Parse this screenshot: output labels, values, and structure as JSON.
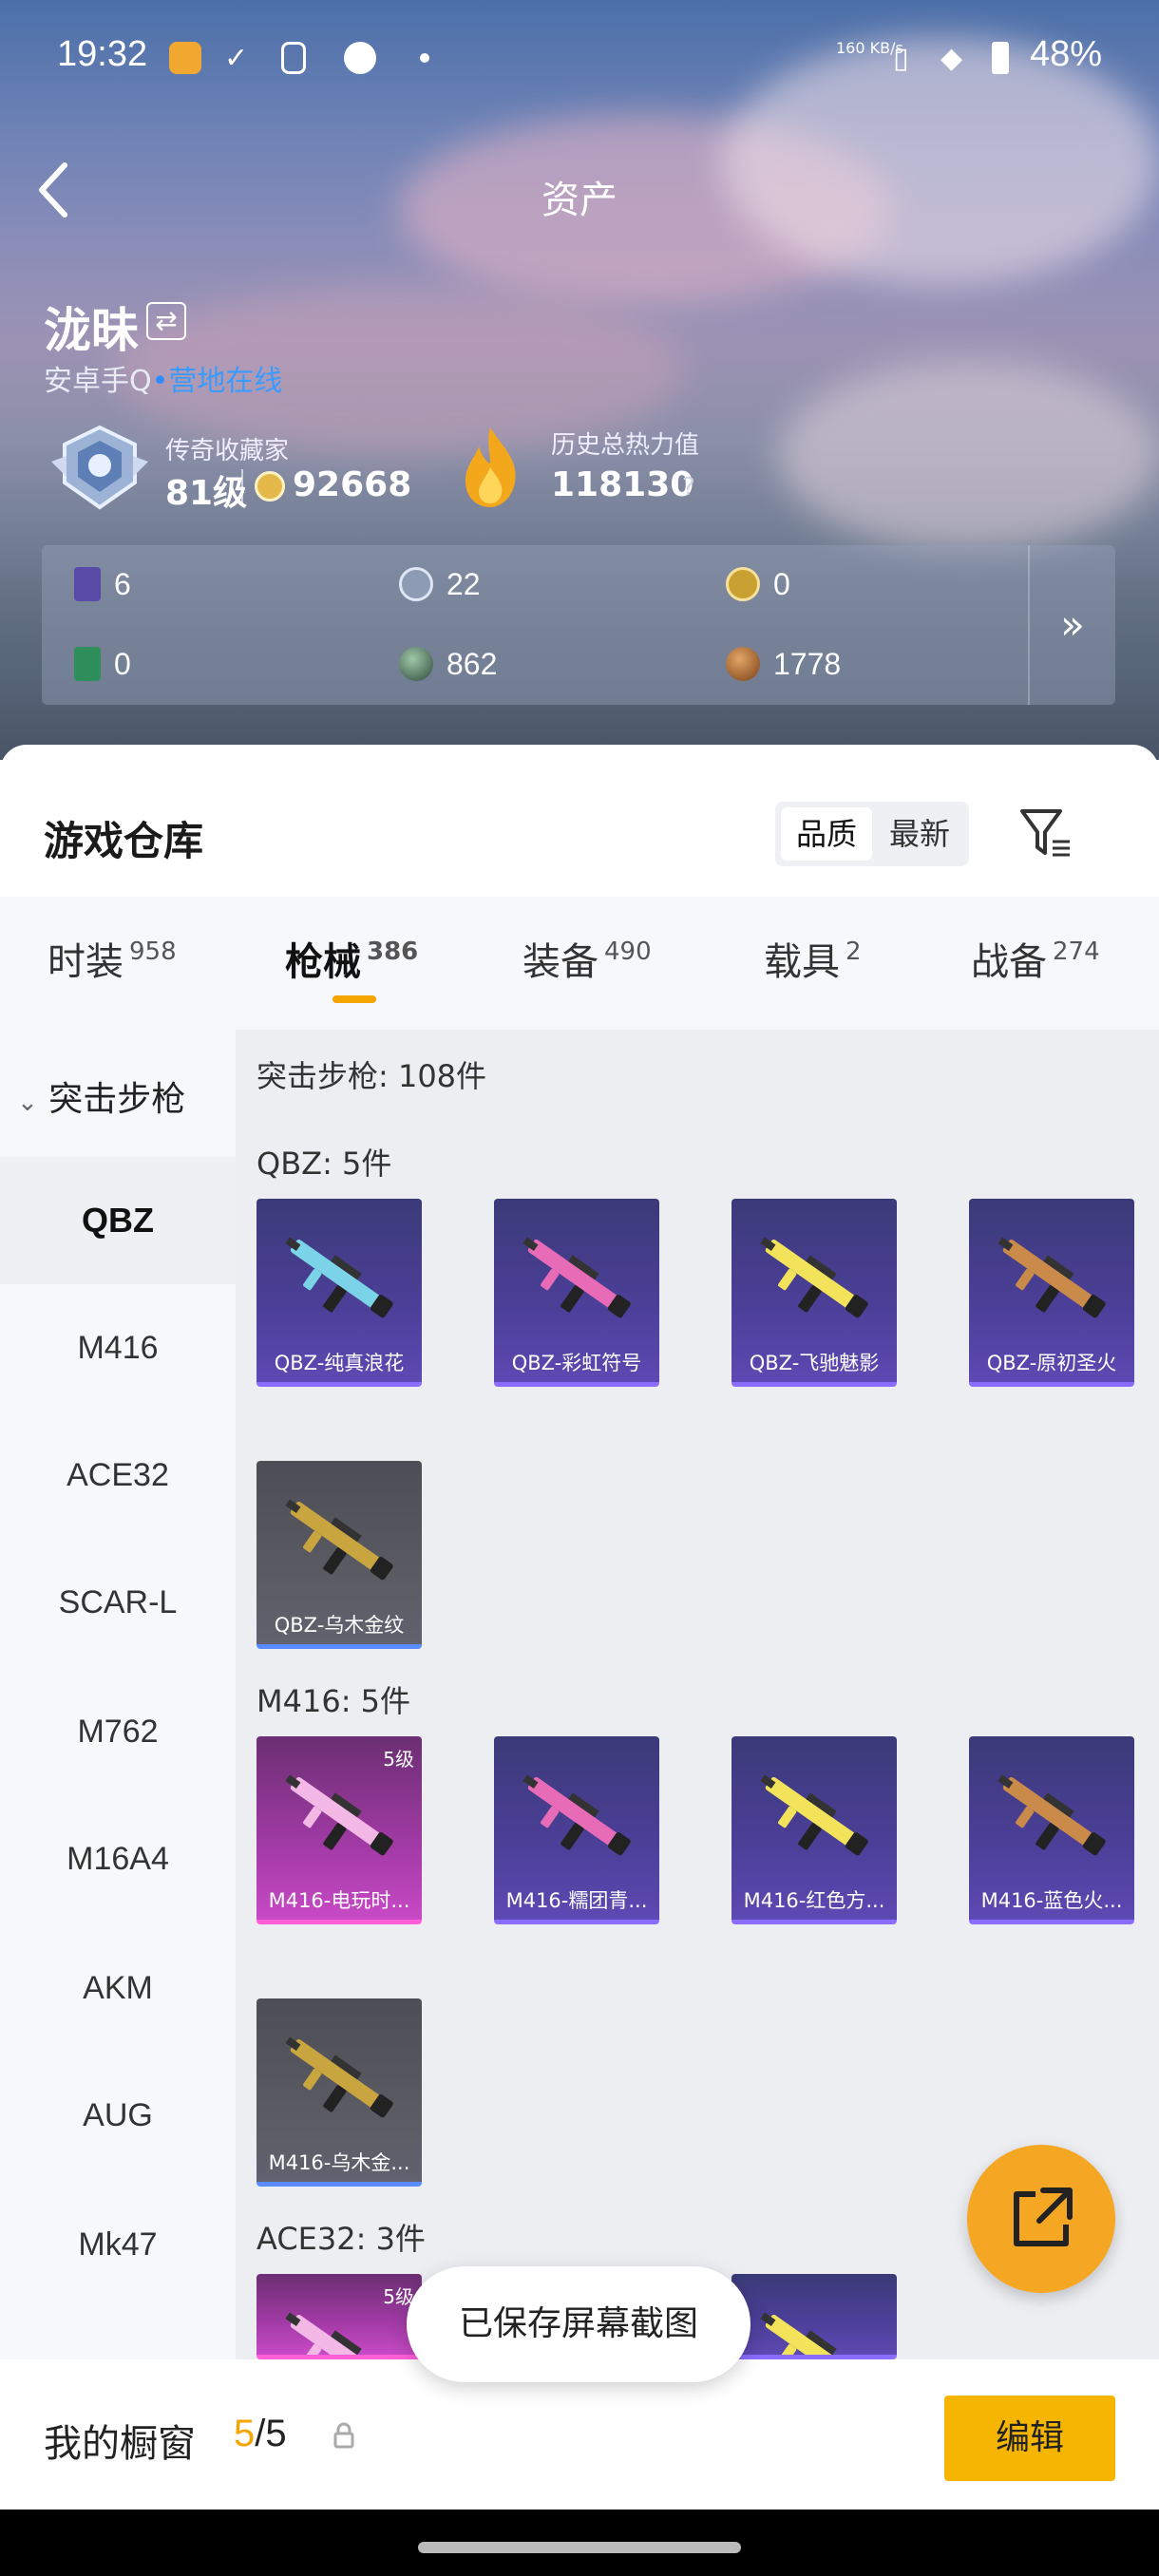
{
  "status_bar": {
    "time": "19:32",
    "net_speed": "160 KB/s",
    "battery": "48%"
  },
  "header": {
    "title": "资产"
  },
  "profile": {
    "name": "泷昧",
    "platform": "安卓手Q",
    "status": "营地在线",
    "rank_title": "传奇收藏家",
    "level": "81级",
    "coins": "92668",
    "heat_title": "历史总热力值",
    "heat_value": "118130",
    "help": "?"
  },
  "stats": [
    {
      "icon": "purple-card-icon",
      "value": "6"
    },
    {
      "icon": "silver-medal-icon",
      "value": "22"
    },
    {
      "icon": "gold-medal-icon",
      "value": "0"
    },
    {
      "icon": "green-card-icon",
      "value": "0"
    },
    {
      "icon": "dark-orb-icon",
      "value": "862"
    },
    {
      "icon": "bronze-coin-icon",
      "value": "1778"
    }
  ],
  "warehouse": {
    "title": "游戏仓库",
    "sort_options": [
      "品质",
      "最新"
    ],
    "tabs": [
      {
        "label": "时装",
        "count": "958"
      },
      {
        "label": "枪械",
        "count": "386"
      },
      {
        "label": "装备",
        "count": "490"
      },
      {
        "label": "载具",
        "count": "2"
      },
      {
        "label": "战备",
        "count": "274"
      }
    ],
    "category": "突击步枪",
    "sidebar_items": [
      "QBZ",
      "M416",
      "ACE32",
      "SCAR-L",
      "M762",
      "M16A4",
      "AKM",
      "AUG",
      "Mk47"
    ],
    "summary": "突击步枪: 108件",
    "groups": [
      {
        "label": "QBZ: 5件",
        "items": [
          {
            "name": "QBZ-纯真浪花",
            "rarity": "purple",
            "level": ""
          },
          {
            "name": "QBZ-彩虹符号",
            "rarity": "purple",
            "level": ""
          },
          {
            "name": "QBZ-飞驰魅影",
            "rarity": "purple",
            "level": ""
          },
          {
            "name": "QBZ-原初圣火",
            "rarity": "purple",
            "level": ""
          },
          {
            "name": "QBZ-乌木金纹",
            "rarity": "gray",
            "level": ""
          }
        ]
      },
      {
        "label": "M416: 5件",
        "items": [
          {
            "name": "M416-电玩时...",
            "rarity": "pink",
            "level": "5级"
          },
          {
            "name": "M416-糯团青...",
            "rarity": "purple",
            "level": ""
          },
          {
            "name": "M416-红色方...",
            "rarity": "purple",
            "level": ""
          },
          {
            "name": "M416-蓝色火...",
            "rarity": "purple",
            "level": ""
          },
          {
            "name": "M416-乌木金...",
            "rarity": "gray",
            "level": ""
          }
        ]
      },
      {
        "label": "ACE32: 3件",
        "items": [
          {
            "name": "",
            "rarity": "pink",
            "level": "5级"
          },
          {
            "name": "",
            "rarity": "purple",
            "level": ""
          },
          {
            "name": "",
            "rarity": "purple",
            "level": ""
          }
        ]
      }
    ]
  },
  "toast": "已保存屏幕截图",
  "showcase": {
    "label": "我的橱窗",
    "current": "5",
    "total": "/5",
    "edit": "编辑"
  },
  "colors": {
    "accent": "#f5a500",
    "online": "#3a9bff",
    "purple_rarity": "#4c3f99",
    "pink_rarity": "#a23aa6"
  }
}
